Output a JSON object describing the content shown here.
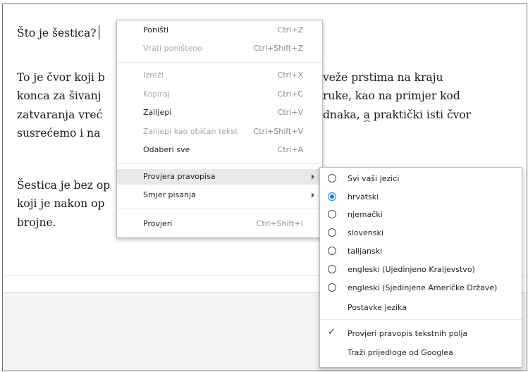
{
  "document": {
    "line1": "Što je šestica?",
    "para2": [
      "To je čvor koji b",
      "konca za šivanj",
      "zatvaranja vreć",
      "susrećemo i na"
    ],
    "para2_right": [
      "veže prstima na kraju",
      "ruke, kao na primjer kod",
      "dnaka, a praktički isti čvor"
    ],
    "para2_right_r3_a": "dnaka, ",
    "para2_right_r3_b": "a",
    "para2_right_r3_c": " praktički isti čvor",
    "para3": [
      "Šestica je bez op",
      "koji je nakon op",
      "brojne."
    ]
  },
  "context_menu": {
    "items": [
      {
        "label": "Poništi",
        "shortcut": "Ctrl+Z",
        "enabled": true
      },
      {
        "label": "Vrati poništeno",
        "shortcut": "Ctrl+Shift+Z",
        "enabled": false
      },
      {
        "label": "Izreži",
        "shortcut": "Ctrl+X",
        "enabled": false
      },
      {
        "label": "Kopiraj",
        "shortcut": "Ctrl+C",
        "enabled": false
      },
      {
        "label": "Zalijepi",
        "shortcut": "Ctrl+V",
        "enabled": true
      },
      {
        "label": "Zalijepi kao običan tekst",
        "shortcut": "Ctrl+Shift+V",
        "enabled": false
      },
      {
        "label": "Odaberi sve",
        "shortcut": "Ctrl+A",
        "enabled": true
      },
      {
        "label": "Provjera pravopisa",
        "shortcut": "",
        "enabled": true,
        "submenu": true,
        "highlighted": true
      },
      {
        "label": "Smjer pisanja",
        "shortcut": "",
        "enabled": true,
        "submenu": true
      },
      {
        "label": "Provjeri",
        "shortcut": "Ctrl+Shift+I",
        "enabled": true
      }
    ]
  },
  "spellcheck_submenu": {
    "languages": [
      {
        "label": "Svi vaši jezici",
        "selected": false
      },
      {
        "label": "hrvatski",
        "selected": true
      },
      {
        "label": "njemački",
        "selected": false
      },
      {
        "label": "slovenski",
        "selected": false
      },
      {
        "label": "talijanski",
        "selected": false
      },
      {
        "label": "engleski (Ujedinjeno Kraljevstvo)",
        "selected": false
      },
      {
        "label": "engleski (Sjedinjene Američke Države)",
        "selected": false
      }
    ],
    "settings_label": "Postavke jezika",
    "check_fields_label": "Provjeri pravopis tekstnih polja",
    "check_fields_checked": true,
    "google_label": "Traži prijedloge od Googlea"
  },
  "colors": {
    "accent": "#1a73e8",
    "highlight": "#e8e8e8",
    "spell_underline": "#d32f2f"
  }
}
